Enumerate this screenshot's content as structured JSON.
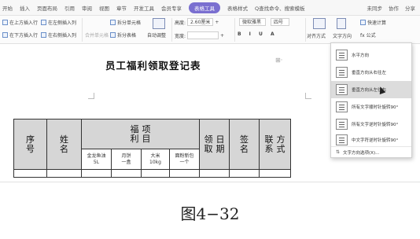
{
  "menubar": {
    "items": [
      "开始",
      "插入",
      "页面布局",
      "引用",
      "审阅",
      "视图",
      "章节",
      "开发工具",
      "会员专享",
      "表格工具",
      "表格样式"
    ],
    "active_index": 9,
    "search": "Q查找命令、搜索模板",
    "right": [
      "未同步",
      "协作",
      "分享"
    ]
  },
  "ribbon": {
    "insert_above": "在上方插入行",
    "insert_left": "在左侧插入列",
    "insert_below": "在下方插入行",
    "insert_right": "在右侧插入列",
    "merge_cells": "合并单元格",
    "split_cells": "拆分单元格",
    "split_table": "拆分表格",
    "auto_fit": "自动调整",
    "height_label": "高度:",
    "height_value": "2.60厘米",
    "width_label": "宽度:",
    "font_name": "微软雅黑",
    "font_size": "四号",
    "align_label": "对齐方式",
    "text_dir_label": "文字方向",
    "quick_calc": "快速计算",
    "formula": "fx 公式"
  },
  "document": {
    "title": "员工福利领取登记表",
    "table": {
      "col_xuhao": "序号",
      "col_xingming": "姓名",
      "col_fuli_line1": "福",
      "col_fuli_line2": "利",
      "col_xiangmu_line1": "项",
      "col_xiangmu_line2": "目",
      "col_lingqu": "领取",
      "col_riqi": "日期",
      "col_qianming": "签名",
      "col_lianxi": "联系",
      "col_fangshi": "方式",
      "sub": [
        {
          "line1": "金龙鱼油",
          "line2": "5L"
        },
        {
          "line1": "月饼",
          "line2": "一盒"
        },
        {
          "line1": "大米",
          "line2": "10kg"
        },
        {
          "line1": "面粉新包",
          "line2": "一个"
        }
      ]
    }
  },
  "dropdown": {
    "items": [
      {
        "label": "水平方向",
        "highlight": false
      },
      {
        "label": "垂直方向从右往左",
        "highlight": false
      },
      {
        "label": "垂直方向从左往右",
        "highlight": true
      },
      {
        "label": "所有文字顺时针旋转90°",
        "highlight": false
      },
      {
        "label": "所有文字逆时针旋转90°",
        "highlight": false
      },
      {
        "label": "中文字符逆时针旋转90°",
        "highlight": false
      }
    ],
    "footer": "文字方向选项(X)..."
  },
  "caption": "图4−32"
}
